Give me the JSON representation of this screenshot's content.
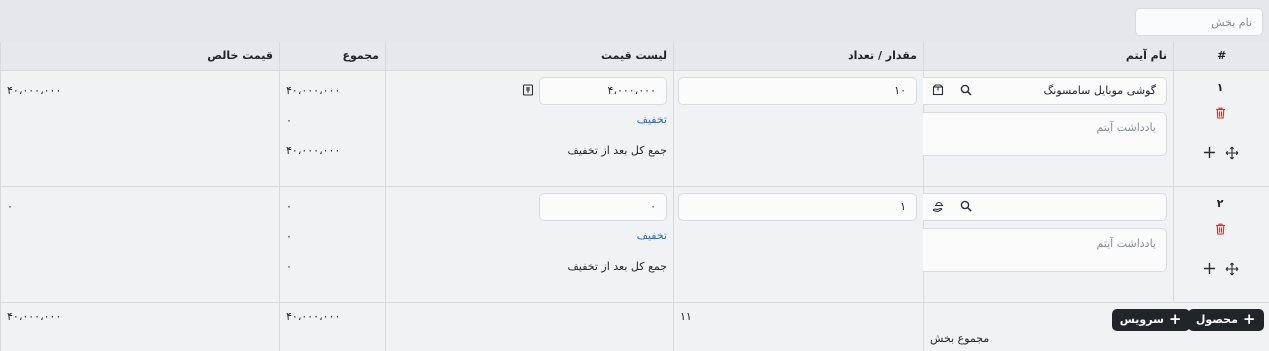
{
  "section": {
    "name_placeholder": "نام بخش"
  },
  "columns": {
    "num": "#",
    "item": "نام آیتم",
    "qty": "مقدار / تعداد",
    "price": "لیست قیمت",
    "total": "مجموع",
    "net": "قیمت خالص"
  },
  "rows": [
    {
      "num": "۱",
      "item_value": "گوشی موبایل سامسونگ",
      "note_placeholder": "یادداشت آیتم",
      "qty": "۱۰",
      "price": "۴،۰۰۰،۰۰۰",
      "discount_label": "تخفیف",
      "after_discount_label": "جمع کل بعد از تخفیف",
      "total": "۴۰،۰۰۰،۰۰۰",
      "discount_value": "۰",
      "total_after": "۴۰،۰۰۰،۰۰۰",
      "net": "۴۰،۰۰۰،۰۰۰"
    },
    {
      "num": "۲",
      "item_value": "",
      "note_placeholder": "یادداشت آیتم",
      "qty": "۱",
      "price": "۰",
      "discount_label": "تخفیف",
      "after_discount_label": "جمع کل بعد از تخفیف",
      "total": "۰",
      "discount_value": "۰",
      "total_after": "۰",
      "net": "۰"
    }
  ],
  "footer": {
    "add_product": "محصول",
    "add_service": "سرویس",
    "section_total_label": "مجموع بخش",
    "qty_total": "۱۱",
    "total": "۴۰،۰۰۰،۰۰۰",
    "net": "۴۰،۰۰۰،۰۰۰"
  },
  "icons": {
    "search": "search-icon",
    "product": "box-icon",
    "service": "service-icon",
    "price": "price-icon",
    "delete": "trash-icon",
    "add": "plus-icon",
    "move": "move-icon"
  },
  "colors": {
    "link": "#2b6cd0",
    "delete": "#d9302c",
    "button": "#212429"
  }
}
